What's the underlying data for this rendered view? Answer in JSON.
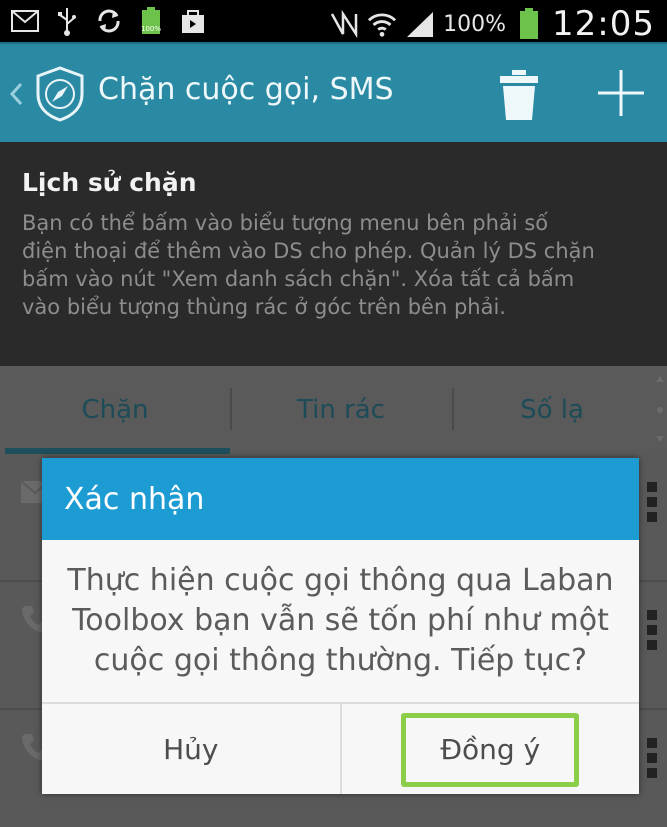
{
  "status_bar": {
    "battery_percent": "100%",
    "time": "12:05",
    "icons": [
      "mail-icon",
      "usb-icon",
      "sync-icon",
      "battery-charging-icon",
      "bag-icon",
      "nfc-icon",
      "wifi-icon",
      "signal-icon",
      "battery-icon"
    ]
  },
  "action_bar": {
    "title": "Chặn cuộc gọi, SMS",
    "accent_color": "#2a8aa3"
  },
  "info": {
    "title": "Lịch sử chặn",
    "lines": [
      "Bạn có thể bấm vào biểu tượng menu bên phải số",
      "điện thoại để thêm vào DS cho phép. Quản lý DS chặn",
      "bấm vào nút \"Xem danh sách chặn\". Xóa tất cả bấm",
      "vào biểu tượng thùng rác ở góc trên bên phải."
    ]
  },
  "tabs": [
    {
      "label": "Chặn",
      "selected": true
    },
    {
      "label": "Tin rác",
      "selected": false
    },
    {
      "label": "Số lạ",
      "selected": false
    }
  ],
  "dialog": {
    "title": "Xác nhận",
    "message_lines": [
      "Thực hiện cuộc gọi thông qua Laban",
      "Toolbox bạn vẫn sẽ tốn phí như một",
      "cuộc gọi thông thường. Tiếp tục?"
    ],
    "cancel_label": "Hủy",
    "ok_label": "Đồng ý",
    "header_color": "#1d9bd3",
    "highlight_color": "#8ccd4a"
  }
}
